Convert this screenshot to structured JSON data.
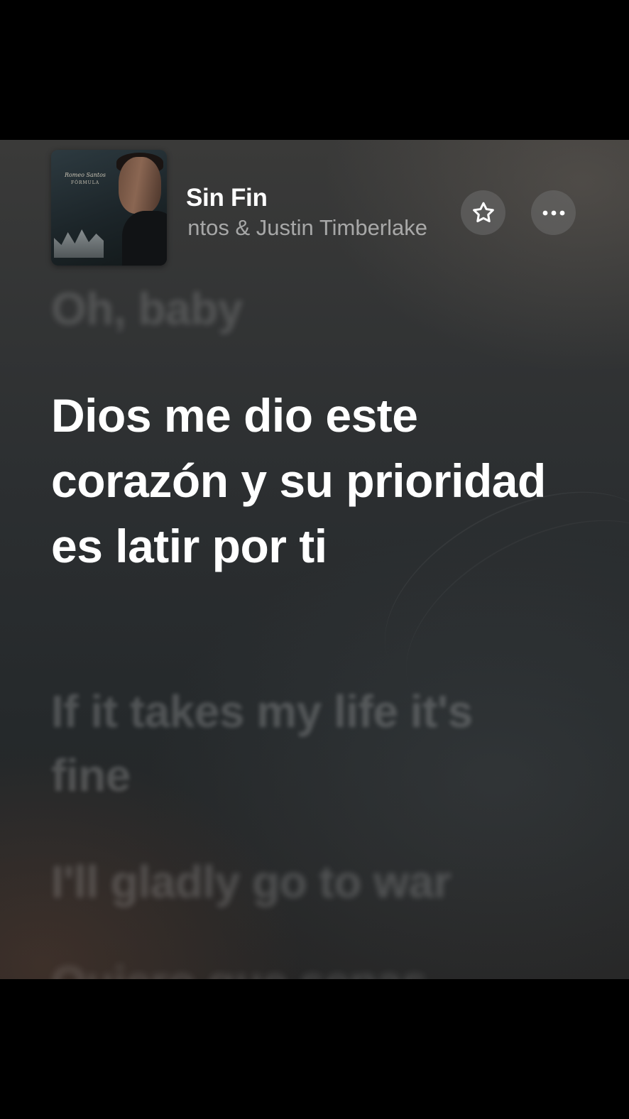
{
  "now_playing": {
    "title": "Sin Fin",
    "artist": "Romeo Santos & Justin Timberlake",
    "artist_visible": "ntos & Justin Timberlake",
    "album_art": {
      "artist_signature": "Romeo Santos",
      "album_title": "FÓRMULA"
    }
  },
  "controls": {
    "favorite_icon": "star-outline-icon",
    "more_icon": "ellipsis-icon"
  },
  "lyrics": {
    "previous": "Oh, baby",
    "current": "Dios me dio este corazón y su prioridad es latir por ti",
    "next": [
      "If it takes my life it's fine",
      "I'll gladly go to war",
      "Quiero que sepas"
    ]
  },
  "colors": {
    "background_top": "#3a3a39",
    "background_bottom": "#25292b",
    "active_lyric": "#ffffff",
    "button_bg": "#6e6e6e"
  }
}
